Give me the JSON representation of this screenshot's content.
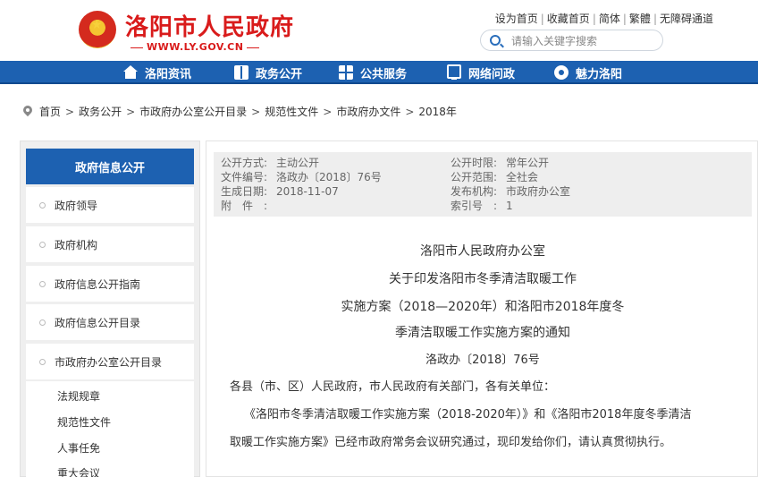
{
  "header": {
    "site_title": "洛阳市人民政府",
    "site_url": "WWW.LY.GOV.CN",
    "top_links": [
      "设为首页",
      "收藏首页",
      "简体",
      "繁體",
      "无障碍通道"
    ],
    "search_placeholder": "请输入关键字搜索"
  },
  "nav": {
    "items": [
      {
        "label": "洛阳资讯",
        "icon": "house-icon"
      },
      {
        "label": "政务公开",
        "icon": "book-icon"
      },
      {
        "label": "公共服务",
        "icon": "grid-icon"
      },
      {
        "label": "网络问政",
        "icon": "monitor-icon"
      },
      {
        "label": "魅力洛阳",
        "icon": "compass-icon"
      }
    ]
  },
  "breadcrumb": [
    "首页",
    "政务公开",
    "市政府办公室公开目录",
    "规范性文件",
    "市政府办文件",
    "2018年"
  ],
  "sidebar": {
    "title": "政府信息公开",
    "items": [
      "政府领导",
      "政府机构",
      "政府信息公开指南",
      "政府信息公开目录",
      "市政府办公室公开目录"
    ],
    "sub_items": [
      "法规规章",
      "规范性文件",
      "人事任免",
      "重大会议"
    ]
  },
  "meta": {
    "left": [
      {
        "k": "公开方式:",
        "v": "主动公开"
      },
      {
        "k": "文件编号:",
        "v": "洛政办〔2018〕76号"
      },
      {
        "k": "生成日期:",
        "v": "2018-11-07"
      },
      {
        "k": "附　件　:",
        "v": ""
      }
    ],
    "right": [
      {
        "k": "公开时限:",
        "v": "常年公开"
      },
      {
        "k": "公开范围:",
        "v": "全社会"
      },
      {
        "k": "发布机构:",
        "v": "市政府办公室"
      },
      {
        "k": "索引号　:",
        "v": "1"
      }
    ]
  },
  "document": {
    "title_lines": [
      "洛阳市人民政府办公室",
      "关于印发洛阳市冬季清洁取暖工作",
      "实施方案（2018—2020年）和洛阳市2018年度冬",
      "季清洁取暖工作实施方案的通知"
    ],
    "doc_no": "洛政办〔2018〕76号",
    "salutation": "各县（市、区）人民政府，市人民政府有关部门，各有关单位：",
    "para_line1": "《洛阳市冬季清洁取暖工作实施方案（2018-2020年）》和《洛阳市2018年度冬季清洁",
    "para_line2": "取暖工作实施方案》已经市政府常务会议研究通过，现印发给你们，请认真贯彻执行。"
  }
}
